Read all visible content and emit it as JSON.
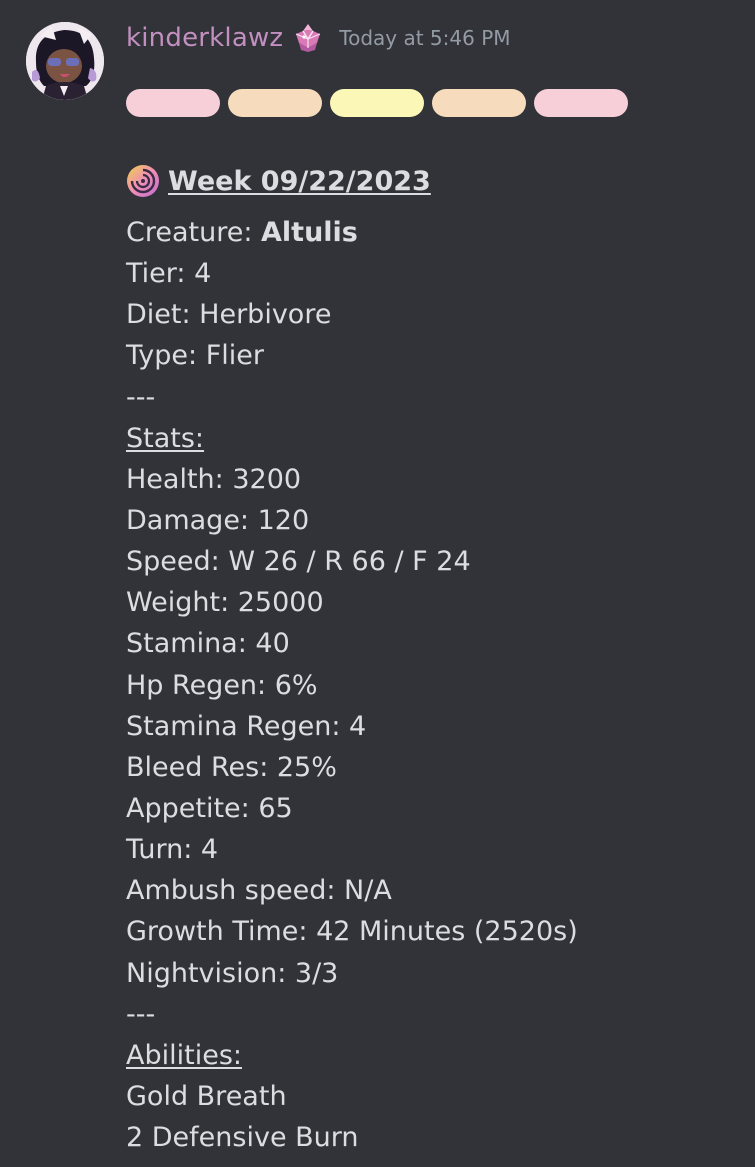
{
  "message": {
    "username": "kinderklawz",
    "timestamp": "Today at 5:46 PM",
    "avatar_icon": "avatar-image",
    "role_badge_icon": "crystal-badge-icon",
    "title_icon": "spiral-icon",
    "pill_colors": [
      "#f6cfd8",
      "#f6dcbd",
      "#fbf7b7",
      "#f6dcbd",
      "#f6cfd8"
    ],
    "title": "Week 09/22/2023",
    "creature_label": "Creature: ",
    "creature_name": "Altulis",
    "tier": "Tier: 4",
    "diet": "Diet: Herbivore",
    "type": "Type: Flier",
    "separator1": "---",
    "stats_heading": "Stats:",
    "stats": [
      "Health: 3200",
      "Damage: 120",
      "Speed: W 26 / R 66 / F 24",
      "Weight: 25000",
      "Stamina: 40",
      "Hp Regen: 6%",
      "Stamina Regen: 4",
      "Bleed Res: 25%",
      "Appetite: 65",
      "Turn: 4",
      "Ambush speed: N/A",
      "Growth Time: 42 Minutes (2520s)",
      "Nightvision: 3/3"
    ],
    "separator2": "---",
    "abilities_heading": "Abilities:",
    "abilities": [
      "Gold Breath",
      "2 Defensive Burn"
    ]
  },
  "colors": {
    "background": "#313338",
    "username": "#c28fc0",
    "text": "#dbdee1",
    "timestamp": "#949ba4"
  }
}
